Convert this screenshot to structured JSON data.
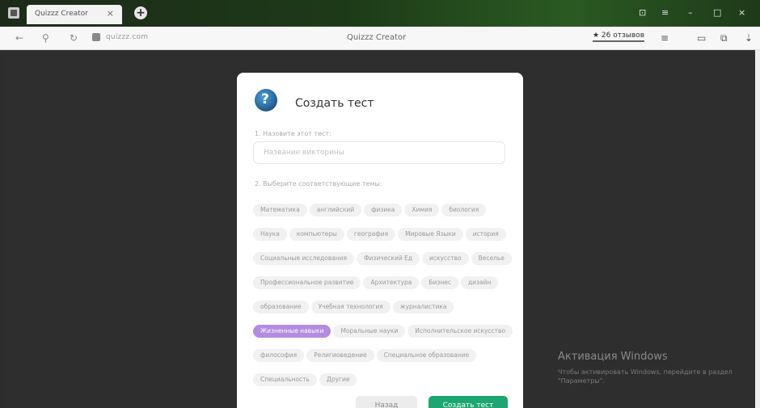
{
  "browser": {
    "tab_title": "Quizzz Creator",
    "tab_close": "×",
    "new_tab": "+",
    "window_controls": [
      "⊡",
      "≡",
      "–",
      "□",
      "×"
    ],
    "url": "quizzz.com",
    "page_title": "Quizzz Creator",
    "reviews": "★ 26 отзывов",
    "toolbar_icons": [
      "≡",
      "▭",
      "⧉",
      "⇣"
    ]
  },
  "modal": {
    "title": "Создать тест",
    "name_label": "1. Назовите этот тест:",
    "name_placeholder": "Название викторины",
    "topics_label": "2. Выберите соответствующие темы:",
    "topics": [
      {
        "label": "Математика",
        "selected": false
      },
      {
        "label": "английский",
        "selected": false
      },
      {
        "label": "физика",
        "selected": false
      },
      {
        "label": "Химия",
        "selected": false
      },
      {
        "label": "биология",
        "selected": false
      },
      {
        "label": "Наука",
        "selected": false
      },
      {
        "label": "компьютеры",
        "selected": false
      },
      {
        "label": "география",
        "selected": false
      },
      {
        "label": "Мировые Языки",
        "selected": false
      },
      {
        "label": "история",
        "selected": false
      },
      {
        "label": "Социальные исследования",
        "selected": false
      },
      {
        "label": "Физический Ед",
        "selected": false
      },
      {
        "label": "искусство",
        "selected": false
      },
      {
        "label": "Веселье",
        "selected": false
      },
      {
        "label": "Профессиональное развитие",
        "selected": false
      },
      {
        "label": "Архитектура",
        "selected": false
      },
      {
        "label": "Бизнес",
        "selected": false
      },
      {
        "label": "дизайн",
        "selected": false
      },
      {
        "label": "образование",
        "selected": false
      },
      {
        "label": "Учебная технология",
        "selected": false
      },
      {
        "label": "журналистика",
        "selected": false
      },
      {
        "label": "Жизненные навыки",
        "selected": true
      },
      {
        "label": "Моральные науки",
        "selected": false
      },
      {
        "label": "Исполнительское искусство",
        "selected": false
      },
      {
        "label": "философия",
        "selected": false
      },
      {
        "label": "Религиоведение",
        "selected": false
      },
      {
        "label": "Специальное образование",
        "selected": false
      },
      {
        "label": "Специальность",
        "selected": false
      },
      {
        "label": "Другие",
        "selected": false
      }
    ],
    "back_button": "Назад",
    "create_button": "Создать тест"
  },
  "watermark": {
    "title": "Активация Windows",
    "subtitle": "Чтобы активировать Windows, перейдите в раздел \"Параметры\"."
  },
  "colors": {
    "accent_green": "#1ea672",
    "selected_chip": "#b48be0"
  }
}
